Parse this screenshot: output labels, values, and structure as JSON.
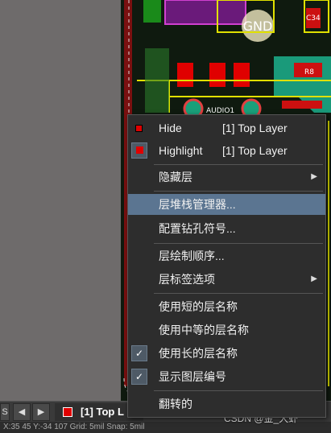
{
  "board": {
    "labels": [
      "GND",
      "C34",
      "R8",
      "AUDIO1"
    ]
  },
  "menu": {
    "items": [
      {
        "label": "Hide",
        "sub": "[1] Top Layer",
        "icon": "red-square-icon"
      },
      {
        "label": "Highlight",
        "sub": "[1] Top Layer",
        "icon": "highlight-icon",
        "checked": true
      },
      {
        "label": "隐藏层",
        "has_submenu": true
      },
      {
        "label": "层堆栈管理器...",
        "highlighted": true
      },
      {
        "label": "配置钻孔符号..."
      },
      {
        "label": "层绘制顺序..."
      },
      {
        "label": "层标签选项",
        "has_submenu": true
      },
      {
        "label": "使用短的层名称"
      },
      {
        "label": "使用中等的层名称"
      },
      {
        "label": "使用长的层名称",
        "checked": true
      },
      {
        "label": "显示图层编号",
        "checked": true
      },
      {
        "label": "翻转的"
      }
    ],
    "check_glyph": "✓",
    "submenu_glyph": "▶"
  },
  "tabbar": {
    "left_label": "S",
    "prev_glyph": "◀",
    "next_glyph": "▶",
    "layer_tab": "[1] Top L",
    "layer_color": "#e00000"
  },
  "statusbar": {
    "text": "X:35 45   Y:-34 107   Grid: 5mil   Snap: 5mil"
  },
  "watermark": {
    "text": "CSDN @金_大虾"
  },
  "colors": {
    "accent_highlight": "#5b7591",
    "menu_bg": "#2d2d2d",
    "top_layer": "#e00000"
  }
}
